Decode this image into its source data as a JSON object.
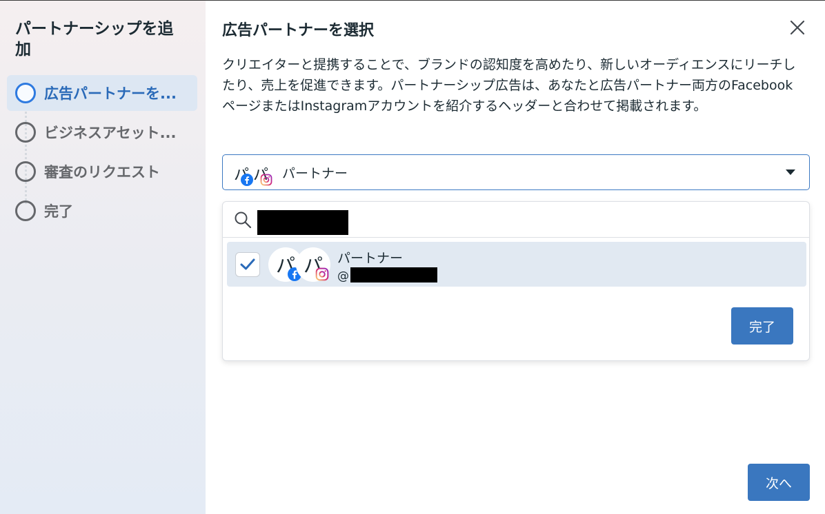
{
  "sidebar": {
    "title": "パートナーシップを追加",
    "steps": [
      {
        "label": "広告パートナーを..."
      },
      {
        "label": "ビジネスアセット..."
      },
      {
        "label": "審査のリクエスト"
      },
      {
        "label": "完了"
      }
    ]
  },
  "main": {
    "title": "広告パートナーを選択",
    "description": "クリエイターと提携することで、ブランドの認知度を高めたり、新しいオーディエンスにリーチしたり、売上を促進できます。パートナーシップ広告は、あなたと広告パートナー両方のFacebookページまたはInstagramアカウントを紹介するヘッダーと合わせて掲載されます。",
    "select": {
      "avatar_text": "パ",
      "selected_label": "パートナー"
    },
    "dropdown": {
      "search_value": "",
      "options": [
        {
          "avatar_text": "パ",
          "name": "パートナー",
          "handle_prefix": "@",
          "checked": true
        }
      ],
      "done_label": "完了"
    },
    "next_label": "次へ"
  },
  "colors": {
    "accent": "#3a77bf",
    "active_step": "#2e7ae0",
    "facebook": "#1877f2",
    "instagram_gradient": [
      "#feda75",
      "#d62976",
      "#962fbf"
    ]
  },
  "icons": {
    "close": "close-icon",
    "search": "search-icon",
    "caret": "caret-down-icon",
    "check": "check-icon",
    "facebook": "facebook-icon",
    "instagram": "instagram-icon"
  }
}
